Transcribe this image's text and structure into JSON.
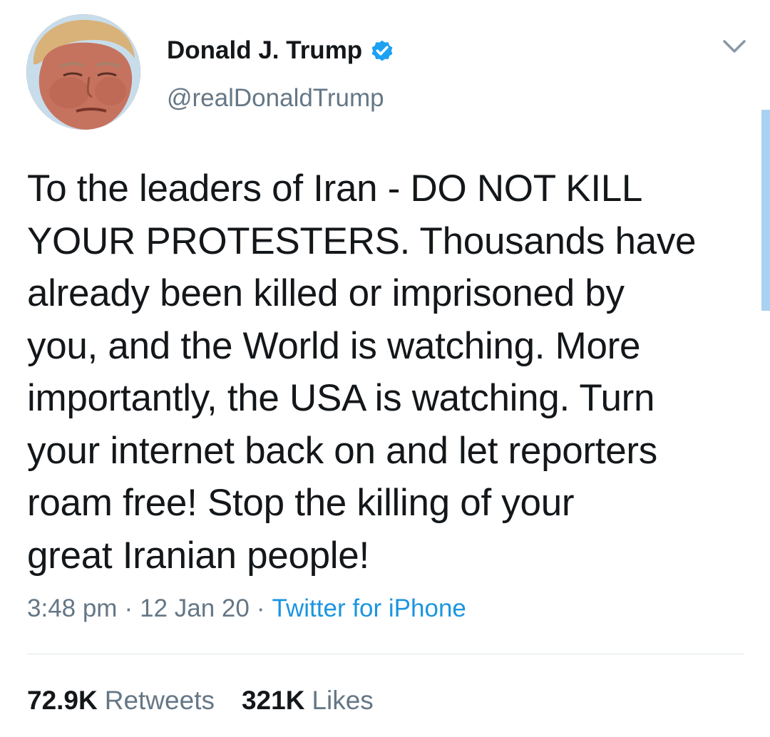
{
  "tweet": {
    "author": {
      "display_name": "Donald J. Trump",
      "handle": "@realDonaldTrump",
      "verified": true
    },
    "text_lines": [
      "To the leaders of Iran - DO NOT KILL",
      "YOUR PROTESTERS. Thousands have",
      "already been killed or imprisoned by",
      "you, and the World is watching. More",
      "importantly, the USA is watching. Turn",
      "your internet back on and let reporters",
      "roam free! Stop the killing of your",
      "great Iranian people!"
    ],
    "time": "3:48 pm",
    "date": "12 Jan 20",
    "separator": "·",
    "source": "Twitter for iPhone",
    "stats": {
      "retweets_count": "72.9K",
      "retweets_label": "Retweets",
      "likes_count": "321K",
      "likes_label": "Likes"
    }
  },
  "icons": {
    "verified": "verified-badge-icon",
    "menu": "chevron-down-icon"
  },
  "colors": {
    "primary_text": "#14171a",
    "secondary_text": "#657786",
    "link": "#1b95e0",
    "verified_badge": "#1da1f2",
    "divider": "#e1e8ed"
  }
}
